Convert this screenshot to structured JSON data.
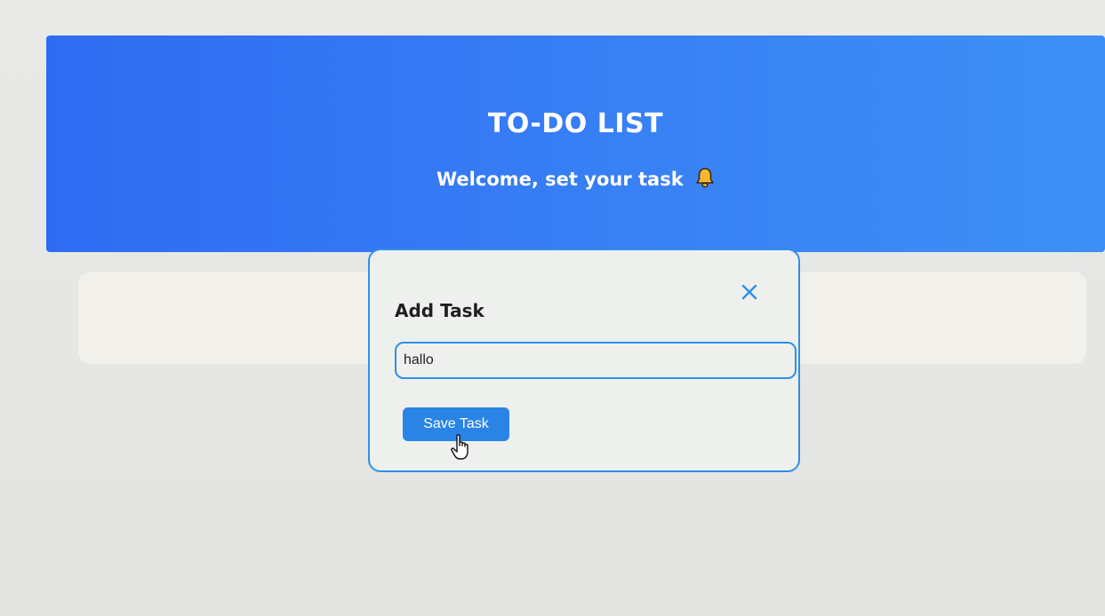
{
  "header": {
    "title": "TO-DO LIST",
    "subtitle": "Welcome, set your task",
    "icon": "bell-icon"
  },
  "modal": {
    "title": "Add Task",
    "close_icon": "close-icon",
    "input_value": "hallo",
    "save_label": "Save Task"
  },
  "colors": {
    "header_bg": "#3a86f5",
    "accent": "#2e8fe8",
    "button_bg": "#2a84e6",
    "bell": "#f5b731"
  }
}
